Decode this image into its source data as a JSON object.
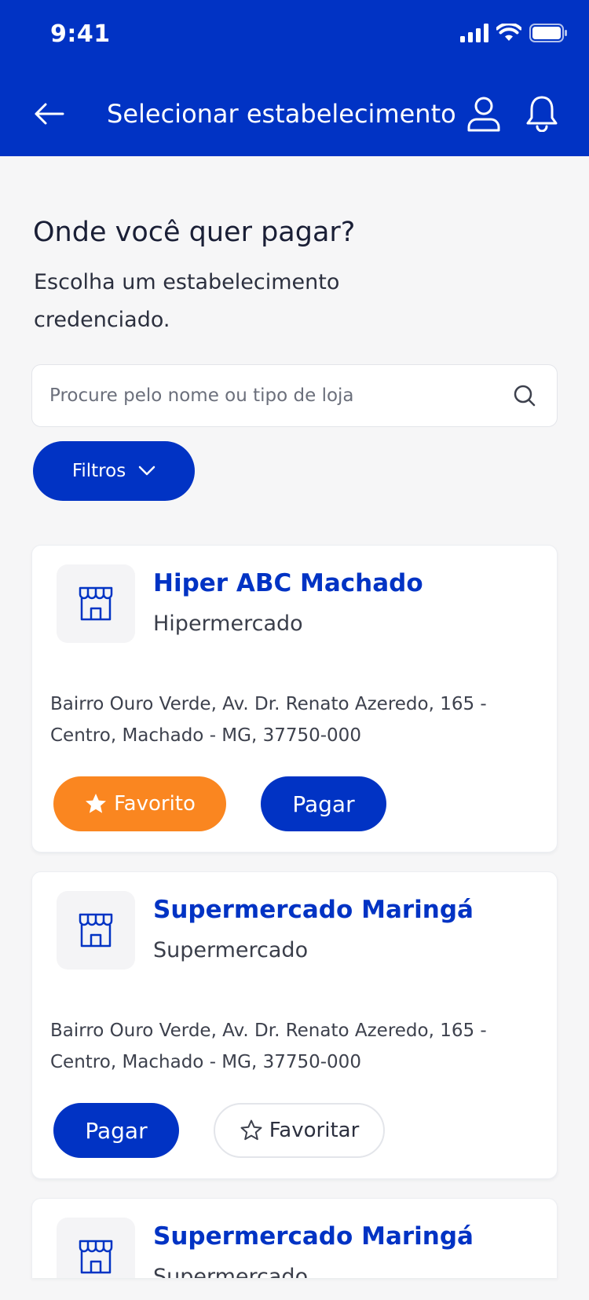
{
  "status_bar": {
    "time": "9:41"
  },
  "header": {
    "title": "Selecionar estabelecimento"
  },
  "intro": {
    "title": "Onde você quer pagar?",
    "subtitle": "Escolha um estabelecimento credenciado."
  },
  "search": {
    "placeholder": "Procure pelo nome ou tipo de loja",
    "value": ""
  },
  "filter": {
    "label": "Filtros"
  },
  "stores": [
    {
      "name": "Hiper ABC Machado",
      "type": "Hipermercado",
      "address": "Bairro Ouro Verde, Av. Dr. Renato Azeredo, 165 - Centro, Machado - MG, 37750-000",
      "favorite": true,
      "favorite_label": "Favorito",
      "pay_label": "Pagar"
    },
    {
      "name": "Supermercado Maringá",
      "type": "Supermercado",
      "address": "Bairro Ouro Verde, Av. Dr. Renato Azeredo, 165 - Centro, Machado - MG, 37750-000",
      "favorite": false,
      "favorite_label": "Favoritar",
      "pay_label": "Pagar"
    },
    {
      "name": "Supermercado Maringá",
      "type": "Supermercado"
    }
  ],
  "colors": {
    "primary": "#0133c4",
    "favorite": "#fa8620",
    "background": "#f6f6f7"
  }
}
